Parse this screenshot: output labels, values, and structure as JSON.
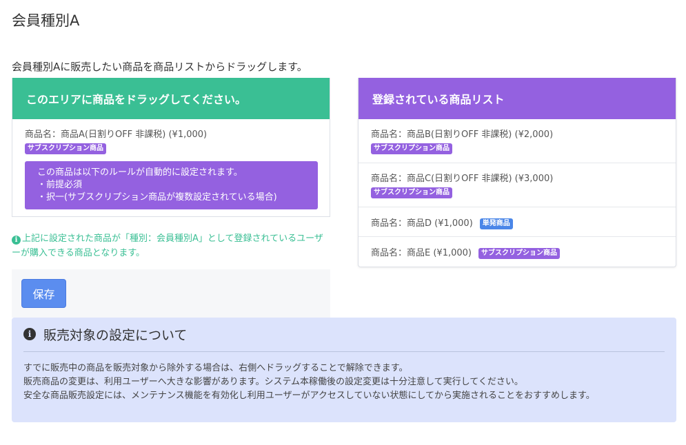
{
  "page": {
    "title": "会員種別A",
    "description": "会員種別Aに販売したい商品を商品リストからドラッグします。"
  },
  "drop_area": {
    "header": "このエリアに商品をドラッグしてください。",
    "items": [
      {
        "name": "商品名：商品A(日割りOFF 非課税) (¥1,000)",
        "badge": "サブスクリプション商品",
        "rule_lines": [
          "この商品は以下のルールが自動的に設定されます。",
          "・前提必須",
          "・択一(サブスクリプション商品が複数設定されている場合)"
        ]
      }
    ]
  },
  "note": {
    "text": "上記に設定された商品が「種別：会員種別A」として登録されているユーザーが購入できる商品となります。"
  },
  "save_button": "保存",
  "product_list": {
    "header": "登録されている商品リスト",
    "items": [
      {
        "name": "商品名：商品B(日割りOFF 非課税) (¥2,000)",
        "badge": "サブスクリプション商品",
        "badge_color": "#9461e0"
      },
      {
        "name": "商品名：商品C(日割りOFF 非課税) (¥3,000)",
        "badge": "サブスクリプション商品",
        "badge_color": "#9461e0"
      },
      {
        "name": "商品名：商品D (¥1,000)",
        "badge": "単発商品",
        "badge_color": "#4a86e8"
      },
      {
        "name": "商品名：商品E (¥1,000)",
        "badge": "サブスクリプション商品",
        "badge_color": "#9461e0"
      }
    ]
  },
  "info": {
    "title": "販売対象の設定について",
    "lines": [
      "すでに販売中の商品を販売対象から除外する場合は、右側へドラッグすることで解除できます。",
      "販売商品の変更は、利用ユーザーへ大きな影響があります。システム本稼働後の設定変更は十分注意して実行してください。",
      "安全な商品販売設定には、メンテナンス機能を有効化し利用ユーザーがアクセスしていない状態にしてから実施されることをおすすめします。"
    ]
  },
  "colors": {
    "green": "#3abf94",
    "purple": "#9461e0",
    "blue": "#4a86e8",
    "info_bg": "#dce3fc"
  }
}
